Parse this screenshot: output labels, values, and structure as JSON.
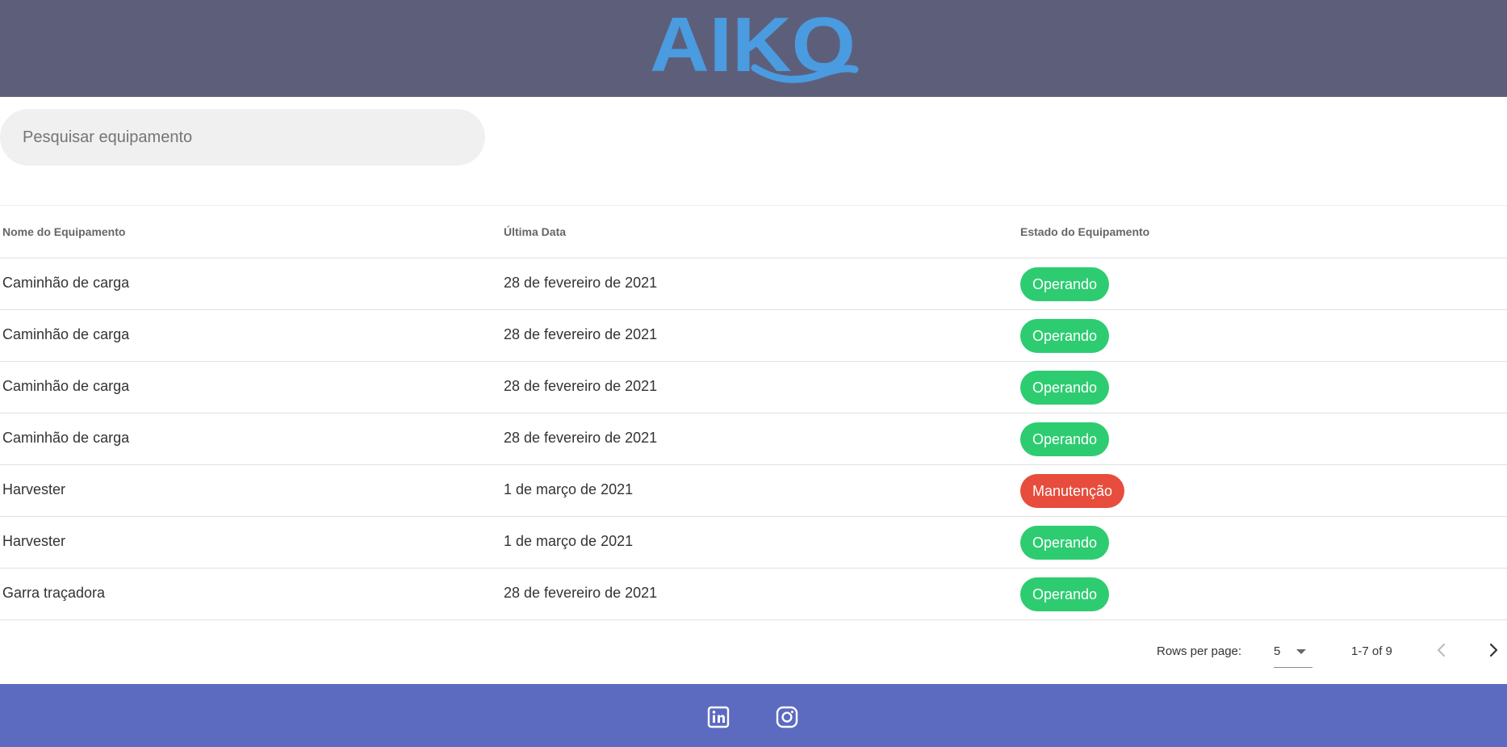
{
  "header": {
    "logo_text": "AIKO"
  },
  "search": {
    "placeholder": "Pesquisar equipamento"
  },
  "table": {
    "headers": [
      "Nome do Equipamento",
      "Última Data",
      "Estado do Equipamento"
    ],
    "rows": [
      {
        "name": "Caminhão de carga",
        "date": "28 de fevereiro de 2021",
        "status": "Operando"
      },
      {
        "name": "Caminhão de carga",
        "date": "28 de fevereiro de 2021",
        "status": "Operando"
      },
      {
        "name": "Caminhão de carga",
        "date": "28 de fevereiro de 2021",
        "status": "Operando"
      },
      {
        "name": "Caminhão de carga",
        "date": "28 de fevereiro de 2021",
        "status": "Operando"
      },
      {
        "name": "Harvester",
        "date": "1 de março de 2021",
        "status": "Manutenção"
      },
      {
        "name": "Harvester",
        "date": "1 de março de 2021",
        "status": "Operando"
      },
      {
        "name": "Garra traçadora",
        "date": "28 de fevereiro de 2021",
        "status": "Operando"
      }
    ]
  },
  "pagination": {
    "rows_per_page_label": "Rows per page:",
    "rows_per_page_value": "5",
    "range": "1-7 of 9"
  },
  "footer": {
    "icons": [
      "linkedin-icon",
      "instagram-icon"
    ]
  },
  "colors": {
    "header_bg": "#5d5f7a",
    "logo": "#4a9be0",
    "operando": "#2ecc71",
    "manutencao": "#e74c3c",
    "footer_bg": "#5c6bc0"
  }
}
